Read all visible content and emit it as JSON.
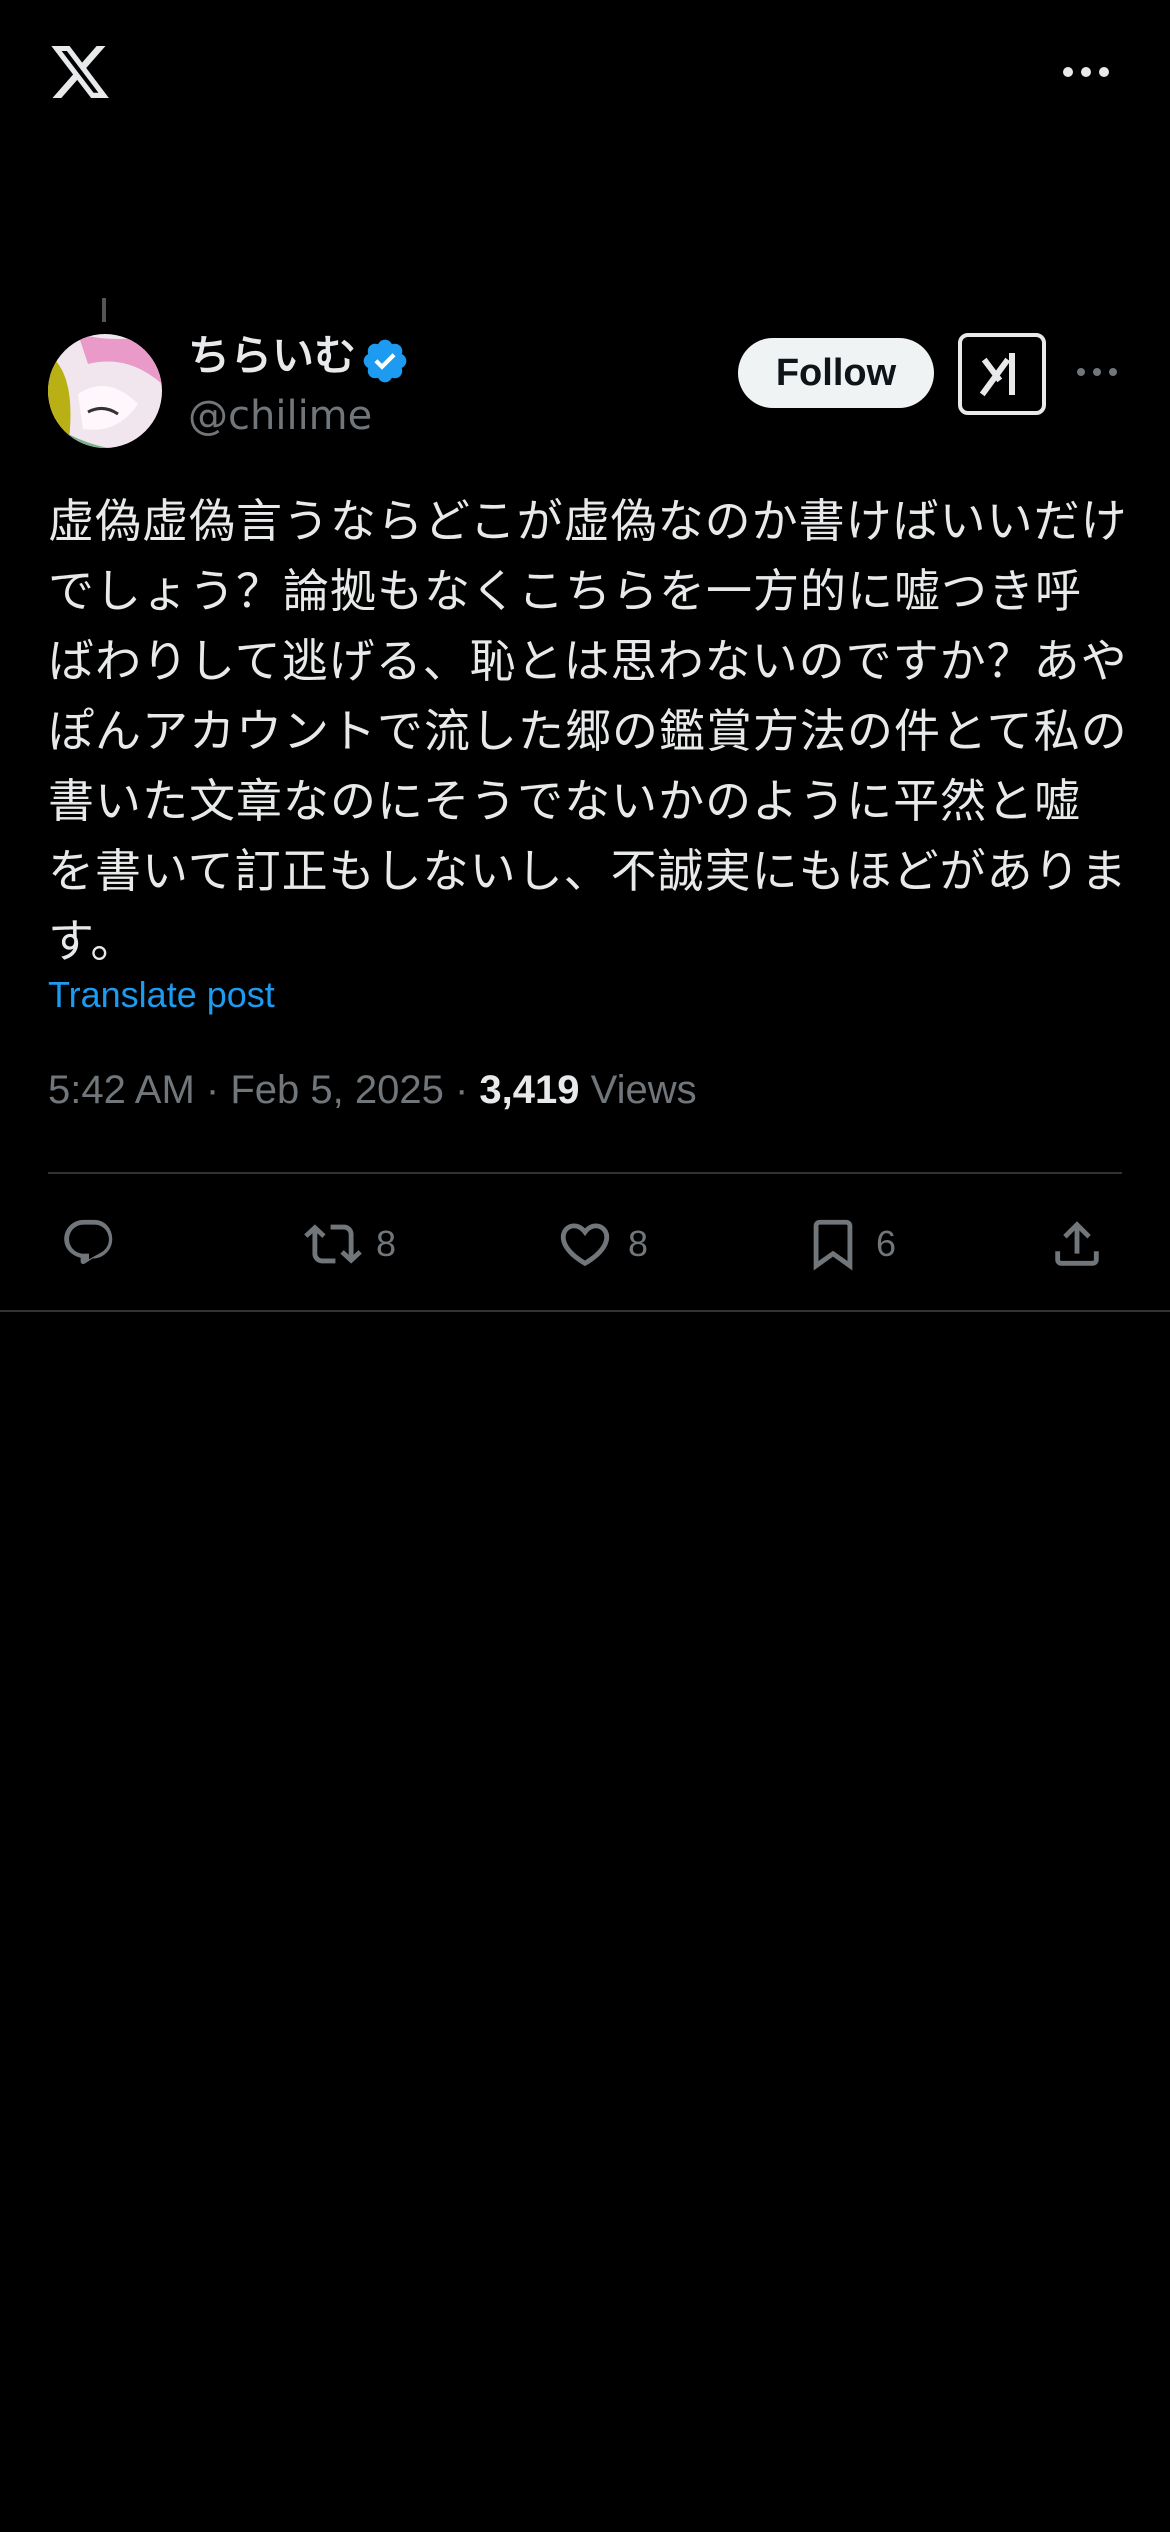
{
  "header": {
    "logo_icon": "x-logo-icon",
    "more_icon": "more-horizontal-icon"
  },
  "tweet": {
    "display_name": "ちらいむ",
    "handle": "@chilime",
    "verified": true,
    "follow_label": "Follow",
    "text": "虚偽虚偽言うならどこが虚偽なのか書けばいいだけでしょう？論拠もなくこちらを一方的に嘘つき呼ばわりして逃げる、恥とは思わないのですか？あやぽんアカウントで流した郷の鑑賞方法の件とて私の書いた文章なのにそうでないかのように平然と嘘を書いて訂正もしないし、不誠実にもほどがあります。",
    "translate_label": "Translate post",
    "time": "5:42 AM",
    "date": "Feb 5, 2025",
    "views_count": "3,419",
    "views_label": "Views"
  },
  "actions": {
    "reply": {
      "icon": "reply-icon",
      "count": ""
    },
    "retweet": {
      "icon": "retweet-icon",
      "count": "8"
    },
    "like": {
      "icon": "heart-icon",
      "count": "8"
    },
    "bookmark": {
      "icon": "bookmark-icon",
      "count": "6"
    },
    "share": {
      "icon": "share-icon"
    }
  },
  "colors": {
    "background": "#000000",
    "accent": "#1d9bf0",
    "muted": "#71767b",
    "text": "#e7e9ea"
  }
}
